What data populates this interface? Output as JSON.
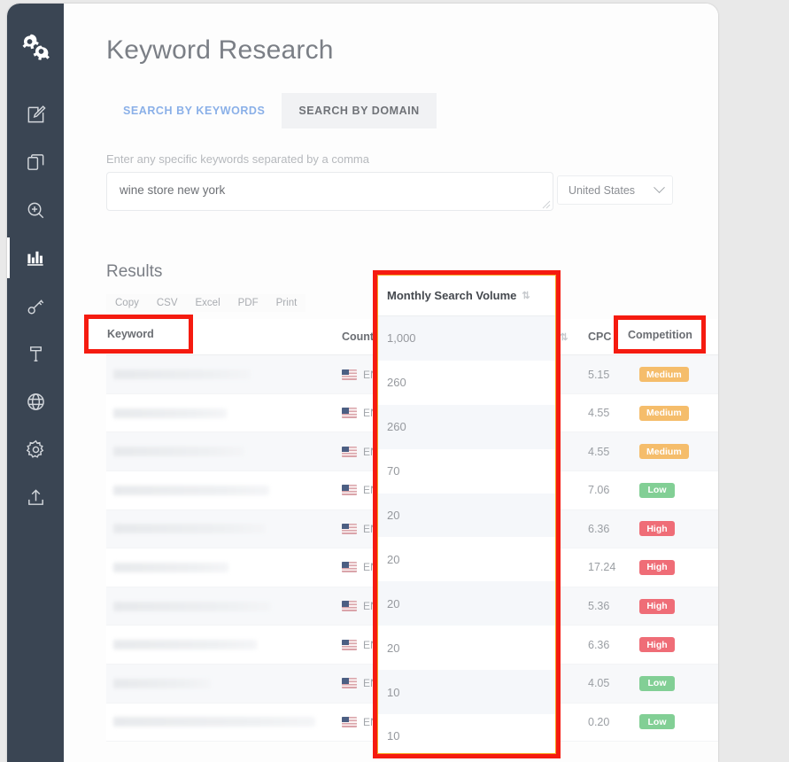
{
  "app": {
    "page_title": "Keyword Research",
    "logo_icon": "gears-logo-icon"
  },
  "sidebar": {
    "items": [
      {
        "icon": "edit-pencil-icon",
        "name": "sidebar-item-edit",
        "active": false
      },
      {
        "icon": "copy-files-icon",
        "name": "sidebar-item-projects",
        "active": false
      },
      {
        "icon": "search-plus-icon",
        "name": "sidebar-item-search",
        "active": false
      },
      {
        "icon": "bar-chart-icon",
        "name": "sidebar-item-reports",
        "active": true
      },
      {
        "icon": "key-icon",
        "name": "sidebar-item-keywords",
        "active": false
      },
      {
        "icon": "hammer-tool-icon",
        "name": "sidebar-item-tools",
        "active": false
      },
      {
        "icon": "globe-icon",
        "name": "sidebar-item-domains",
        "active": false
      },
      {
        "icon": "gear-icon",
        "name": "sidebar-item-settings",
        "active": false
      },
      {
        "icon": "upload-icon",
        "name": "sidebar-item-upload",
        "active": false
      }
    ]
  },
  "tabs": [
    {
      "label": "SEARCH BY KEYWORDS",
      "active": true
    },
    {
      "label": "SEARCH BY DOMAIN",
      "active": false
    }
  ],
  "search_form": {
    "hint": "Enter any specific keywords separated by a comma",
    "keyword_value": "wine store new york",
    "keyword_placeholder": "Enter any specific keywords separated by a comma",
    "country_value": "United States",
    "chevron_icon": "chevron-down-icon"
  },
  "results": {
    "title": "Results",
    "export_buttons": [
      "Copy",
      "CSV",
      "Excel",
      "PDF",
      "Print"
    ],
    "columns": [
      {
        "label": "Keyword",
        "sortable": true
      },
      {
        "label": "Country",
        "sortable": false
      },
      {
        "label": "Monthly Search Volume",
        "sortable": true
      },
      {
        "label": "CPC",
        "sortable": true
      },
      {
        "label": "Competition",
        "sortable": false
      }
    ],
    "sort_icon": "sort-updown-icon",
    "rows": [
      {
        "keyword": "",
        "keyword_redacted": true,
        "redact_width": 155,
        "flag": "us-flag-icon",
        "lang": "EN",
        "volume": "1,000",
        "cpc": "5.15",
        "competition": "Medium"
      },
      {
        "keyword": "",
        "keyword_redacted": true,
        "redact_width": 128,
        "flag": "us-flag-icon",
        "lang": "EN",
        "volume": "260",
        "cpc": "4.55",
        "competition": "Medium"
      },
      {
        "keyword": "",
        "keyword_redacted": true,
        "redact_width": 148,
        "flag": "us-flag-icon",
        "lang": "EN",
        "volume": "260",
        "cpc": "4.55",
        "competition": "Medium"
      },
      {
        "keyword": "",
        "keyword_redacted": true,
        "redact_width": 176,
        "flag": "us-flag-icon",
        "lang": "EN",
        "volume": "70",
        "cpc": "7.06",
        "competition": "Low"
      },
      {
        "keyword": "",
        "keyword_redacted": true,
        "redact_width": 172,
        "flag": "us-flag-icon",
        "lang": "EN",
        "volume": "20",
        "cpc": "6.36",
        "competition": "High"
      },
      {
        "keyword": "",
        "keyword_redacted": true,
        "redact_width": 130,
        "flag": "us-flag-icon",
        "lang": "EN",
        "volume": "20",
        "cpc": "17.24",
        "competition": "High"
      },
      {
        "keyword": "",
        "keyword_redacted": true,
        "redact_width": 178,
        "flag": "us-flag-icon",
        "lang": "EN",
        "volume": "20",
        "cpc": "5.36",
        "competition": "High"
      },
      {
        "keyword": "",
        "keyword_redacted": true,
        "redact_width": 162,
        "flag": "us-flag-icon",
        "lang": "EN",
        "volume": "20",
        "cpc": "6.36",
        "competition": "High"
      },
      {
        "keyword": "",
        "keyword_redacted": true,
        "redact_width": 110,
        "flag": "us-flag-icon",
        "lang": "EN",
        "volume": "10",
        "cpc": "4.05",
        "competition": "Low"
      },
      {
        "keyword": "",
        "keyword_redacted": true,
        "redact_width": 228,
        "flag": "us-flag-icon",
        "lang": "EN",
        "volume": "10",
        "cpc": "0.20",
        "competition": "Low"
      }
    ]
  },
  "msv_panel": {
    "header": "Monthly Search Volume",
    "sort_icon": "sort-updown-icon",
    "values": [
      "1,000",
      "260",
      "260",
      "70",
      "20",
      "20",
      "20",
      "20",
      "10",
      "10"
    ]
  },
  "annotations": [
    {
      "name": "highlight-keyword-header",
      "label": "Keyword",
      "color": "#f51b10"
    },
    {
      "name": "highlight-msv-column",
      "label": "Monthly Search Volume",
      "color": "#f51b10",
      "inner_color": "#f5a623"
    },
    {
      "name": "highlight-competition-header",
      "label": "Competition",
      "color": "#f51b10"
    }
  ],
  "colors": {
    "sidebar": "#3a4553",
    "accent_blue": "#8ab0e8",
    "badge_medium": "#f5bd6b",
    "badge_low": "#82cf95",
    "badge_high": "#ef6d77",
    "annotation_red": "#f51b10",
    "annotation_orange": "#f5a623",
    "page_background": "#e9e9e9"
  }
}
